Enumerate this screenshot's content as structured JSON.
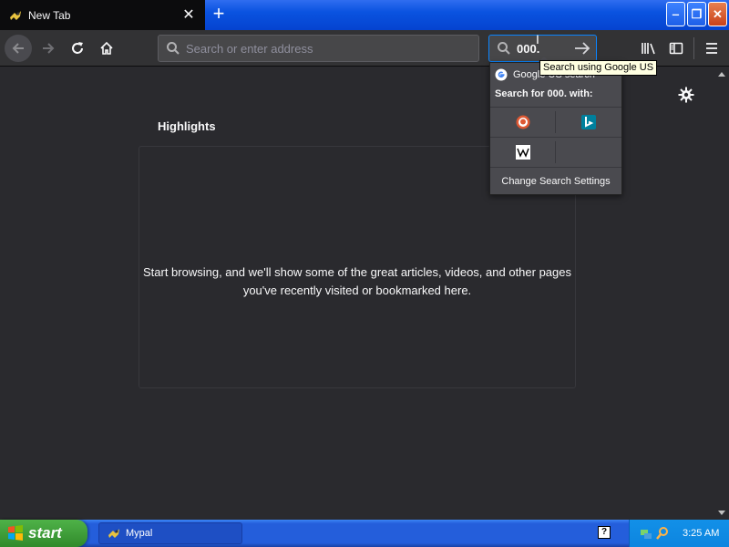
{
  "tab": {
    "title": "New Tab",
    "close": "✕"
  },
  "newtab": "+",
  "window": {
    "minimize": "‒",
    "maximize": "❐",
    "close": "✕"
  },
  "urlbar": {
    "placeholder": "Search or enter address"
  },
  "searchbar": {
    "value": "000."
  },
  "highlights": {
    "title": "Highlights",
    "empty_message": "Start browsing, and we'll show some of the great articles, videos, and other pages you've recently visited or bookmarked here."
  },
  "search_popup": {
    "suggestion": "Google US search",
    "search_for": "Search for 000. with:",
    "engines": [
      "DuckDuckGo",
      "Bing",
      "Wikipedia"
    ],
    "change_settings": "Change Search Settings"
  },
  "tooltip": "Search using Google US",
  "taskbar": {
    "start": "start",
    "task": "Mypal",
    "clock": "3:25 AM",
    "help": "?"
  },
  "colors": {
    "accent": "#0a84ff",
    "content_bg": "#2a2a2e",
    "toolbar_bg": "#323234"
  }
}
